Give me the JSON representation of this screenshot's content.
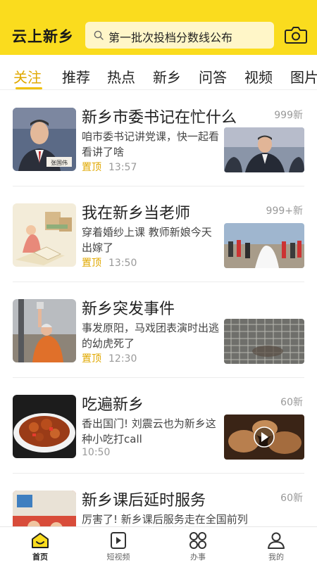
{
  "header": {
    "logo": "云上新乡",
    "search_text": "第一批次投档分数线公布",
    "search_icon": "search-icon",
    "camera_icon": "camera-icon"
  },
  "tabs": [
    {
      "label": "关注",
      "active": true
    },
    {
      "label": "推荐"
    },
    {
      "label": "热点"
    },
    {
      "label": "新乡"
    },
    {
      "label": "问答"
    },
    {
      "label": "视频"
    },
    {
      "label": "图片"
    }
  ],
  "feed": [
    {
      "title": "新乡市委书记在忙什么",
      "count": "999新",
      "desc": "咱市委书记讲党课，快一起看看讲了啥",
      "pin": "置顶",
      "time": "13:57",
      "thumb_label": "张国伟"
    },
    {
      "title": "我在新乡当老师",
      "count": "999+新",
      "desc": "穿着婚纱上课 教师新娘今天出嫁了",
      "pin": "置顶",
      "time": "13:50"
    },
    {
      "title": "新乡突发事件",
      "count": "",
      "desc": "事发原阳，马戏团表演时出逃的幼虎死了",
      "pin": "置顶",
      "time": "12:30"
    },
    {
      "title": "吃遍新乡",
      "count": "60新",
      "desc": "香出国门! 刘震云也为新乡这种小吃打call",
      "pin": "",
      "time": "10:50",
      "pic_icon": "play-icon"
    },
    {
      "title": "新乡课后延时服务",
      "count": "60新",
      "desc": "厉害了! 新乡课后服务走在全国前列",
      "pin": "",
      "time": ""
    }
  ],
  "bottom_nav": [
    {
      "label": "首页",
      "icon": "home-icon",
      "active": true
    },
    {
      "label": "短视频",
      "icon": "video-icon"
    },
    {
      "label": "办事",
      "icon": "services-icon"
    },
    {
      "label": "我的",
      "icon": "profile-icon"
    }
  ],
  "colors": {
    "brand_yellow": "#fadc1e",
    "accent": "#e0a800"
  }
}
